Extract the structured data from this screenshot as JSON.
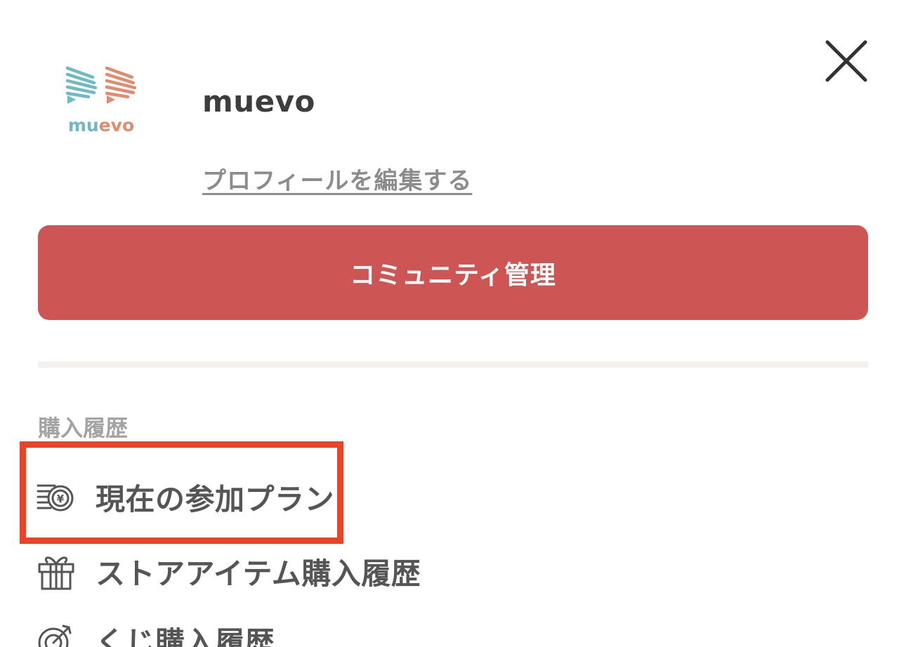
{
  "header": {
    "close_icon": "close-icon",
    "logo_text": "muevo",
    "username": "muevo",
    "edit_profile_label": "プロフィールを編集する"
  },
  "community_button": {
    "label": "コミュニティ管理",
    "color": "#cd5553"
  },
  "purchase_history": {
    "heading": "購入履歴",
    "items": [
      {
        "icon": "yen-coin-icon",
        "label": "現在の参加プラン"
      },
      {
        "icon": "gift-icon",
        "label": "ストアアイテム購入履歴"
      },
      {
        "icon": "target-icon",
        "label": "くじ購入履歴"
      }
    ]
  },
  "highlight": {
    "color": "#e8442a"
  },
  "colors": {
    "logo_teal": "#6fb9c7",
    "logo_coral": "#e18c6f",
    "text_dark": "#3d3d3d",
    "text_muted": "#8c8c8c"
  }
}
